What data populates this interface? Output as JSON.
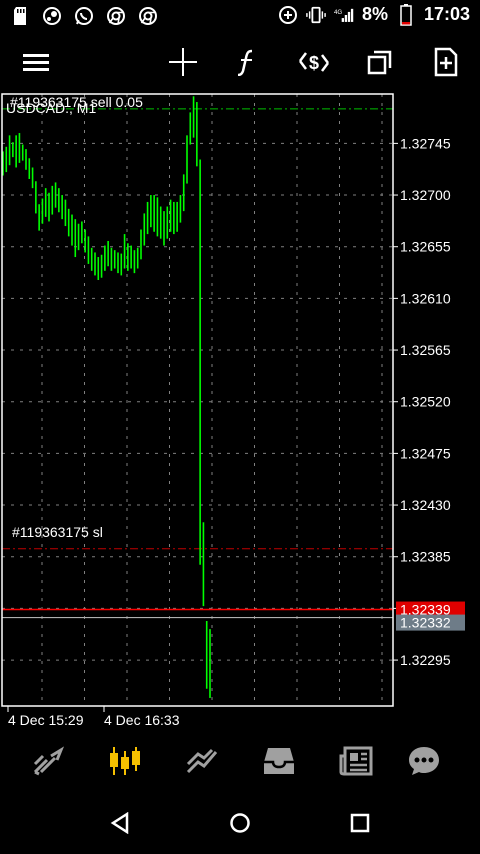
{
  "status_bar": {
    "battery_percent": "8%",
    "time": "17:03",
    "network": "4G",
    "left_icons": [
      "sd-card-icon",
      "steam-icon",
      "whatsapp-icon",
      "chrome-icon",
      "chrome-icon"
    ]
  },
  "toolbar": {
    "icons": [
      "menu-icon",
      "crosshair-icon",
      "indicators-icon",
      "trade-icon",
      "windows-icon",
      "new-order-icon"
    ]
  },
  "chart": {
    "symbol_label": "USDCAD., M1",
    "trade_label": "#119363175 sell 0.05",
    "sl_label": "#119363175 sl",
    "bid_price": "1.32339",
    "ask_price": "1.32332",
    "colors": {
      "candles": "#00ff00",
      "trade_line": "#00c000",
      "sl_line": "#c00000",
      "bid_line": "#ff0000",
      "ask_line": "#b0b0b0",
      "grid": "#808080",
      "bid_tag": "#e00000",
      "ask_tag": "#6e7c88"
    }
  },
  "chart_data": {
    "type": "bar",
    "yticks": [
      "1.32745",
      "1.32700",
      "1.32655",
      "1.32610",
      "1.32565",
      "1.32520",
      "1.32475",
      "1.32430",
      "1.32385",
      "1.32340",
      "1.32295"
    ],
    "ylim": [
      1.32255,
      1.32788
    ],
    "x_labels": [
      "4 Dec 15:29",
      "4 Dec 16:33"
    ],
    "trade_level": 1.32775,
    "sl_level": 1.32392,
    "bid_level": 1.32339,
    "ask_level": 1.32332,
    "bars": [
      [
        1.32717,
        1.32738
      ],
      [
        1.3272,
        1.32742
      ],
      [
        1.32726,
        1.32752
      ],
      [
        1.32733,
        1.32746
      ],
      [
        1.32724,
        1.32752
      ],
      [
        1.32728,
        1.32754
      ],
      [
        1.3273,
        1.32744
      ],
      [
        1.32722,
        1.3274
      ],
      [
        1.32714,
        1.32732
      ],
      [
        1.32706,
        1.32724
      ],
      [
        1.32684,
        1.32712
      ],
      [
        1.32669,
        1.32692
      ],
      [
        1.32675,
        1.32697
      ],
      [
        1.32681,
        1.32706
      ],
      [
        1.32677,
        1.32702
      ],
      [
        1.32683,
        1.32708
      ],
      [
        1.32689,
        1.32711
      ],
      [
        1.32685,
        1.32706
      ],
      [
        1.32679,
        1.327
      ],
      [
        1.32673,
        1.32696
      ],
      [
        1.32664,
        1.32688
      ],
      [
        1.32656,
        1.32683
      ],
      [
        1.32646,
        1.32679
      ],
      [
        1.32652,
        1.32675
      ],
      [
        1.32658,
        1.32677
      ],
      [
        1.3265,
        1.3267
      ],
      [
        1.3264,
        1.32664
      ],
      [
        1.32634,
        1.32654
      ],
      [
        1.3263,
        1.3265
      ],
      [
        1.32626,
        1.32646
      ],
      [
        1.32628,
        1.32648
      ],
      [
        1.32634,
        1.32656
      ],
      [
        1.32638,
        1.3266
      ],
      [
        1.32634,
        1.32654
      ],
      [
        1.32636,
        1.32652
      ],
      [
        1.32632,
        1.3265
      ],
      [
        1.3263,
        1.32649
      ],
      [
        1.32636,
        1.32666
      ],
      [
        1.32634,
        1.32658
      ],
      [
        1.32636,
        1.32656
      ],
      [
        1.32632,
        1.32652
      ],
      [
        1.32636,
        1.32654
      ],
      [
        1.32644,
        1.3267
      ],
      [
        1.32656,
        1.32684
      ],
      [
        1.32666,
        1.32694
      ],
      [
        1.32672,
        1.327
      ],
      [
        1.32668,
        1.327
      ],
      [
        1.32664,
        1.32698
      ],
      [
        1.32662,
        1.3269
      ],
      [
        1.32656,
        1.32686
      ],
      [
        1.32662,
        1.3269
      ],
      [
        1.32668,
        1.32696
      ],
      [
        1.32666,
        1.32694
      ],
      [
        1.32668,
        1.32694
      ],
      [
        1.32676,
        1.327
      ],
      [
        1.32686,
        1.32718
      ],
      [
        1.3271,
        1.32752
      ],
      [
        1.32744,
        1.32772
      ],
      [
        1.3275,
        1.32786
      ],
      [
        1.32725,
        1.32781
      ],
      [
        1.32378,
        1.32731
      ],
      [
        1.32342,
        1.32415
      ],
      [
        1.3227,
        1.32329
      ],
      [
        1.32262,
        1.32322
      ]
    ]
  },
  "bottom_bar": {
    "icons": [
      "quotes-icon",
      "chart-icon",
      "trade-icon",
      "history-icon",
      "news-icon",
      "chat-icon"
    ],
    "active_index": 1,
    "active_color": "#f5c000",
    "inactive_color": "#a0a0a0"
  }
}
